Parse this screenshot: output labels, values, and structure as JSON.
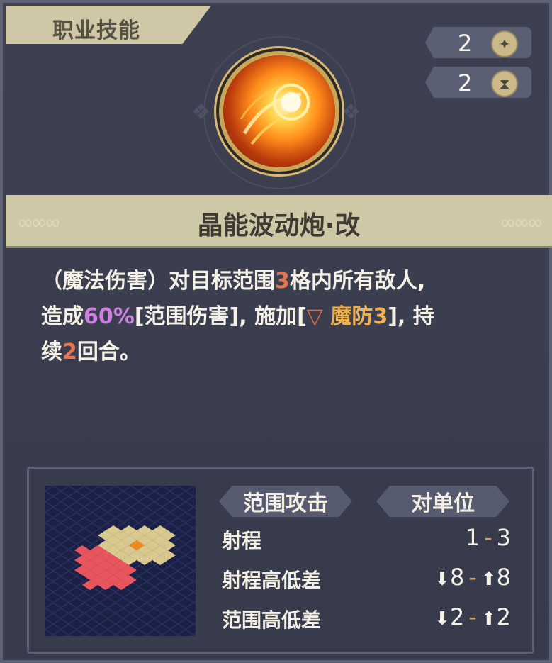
{
  "category": {
    "label": "职业技能"
  },
  "stats": [
    {
      "value": "2",
      "icon": "sparkle-icon",
      "glyph": "✦"
    },
    {
      "value": "2",
      "icon": "hourglass-icon",
      "glyph": "⧗"
    }
  ],
  "skill": {
    "name": "晶能波动炮·改",
    "icon": "energy-cannon-icon"
  },
  "description": {
    "l1_a": "（魔法伤害）对目标范围",
    "l1_num": "3",
    "l1_b": "格内所有敌人,",
    "l2_a": "造成",
    "l2_pct": "60%",
    "l2_b": "[范围伤害], 施加[",
    "l2_debuff_icon": "▽",
    "l2_debuff": "魔防3",
    "l2_c": "], 持",
    "l3_a": "续",
    "l3_num": "2",
    "l3_b": "回合。"
  },
  "info": {
    "tag_area": "范围攻击",
    "tag_target": "对单位",
    "rows": [
      {
        "label": "射程",
        "min": "1",
        "max": "3",
        "arrows": false
      },
      {
        "label": "射程高低差",
        "min": "8",
        "max": "8",
        "arrows": true
      },
      {
        "label": "范围高低差",
        "min": "2",
        "max": "2",
        "arrows": true
      }
    ]
  },
  "colors": {
    "accent_orange": "#e6764f",
    "accent_purple": "#cf7fe0",
    "accent_gold": "#f0b24e",
    "range_tile": "#d9c98f",
    "area_tile": "#e8555c",
    "target_tile": "#f08a1c"
  }
}
